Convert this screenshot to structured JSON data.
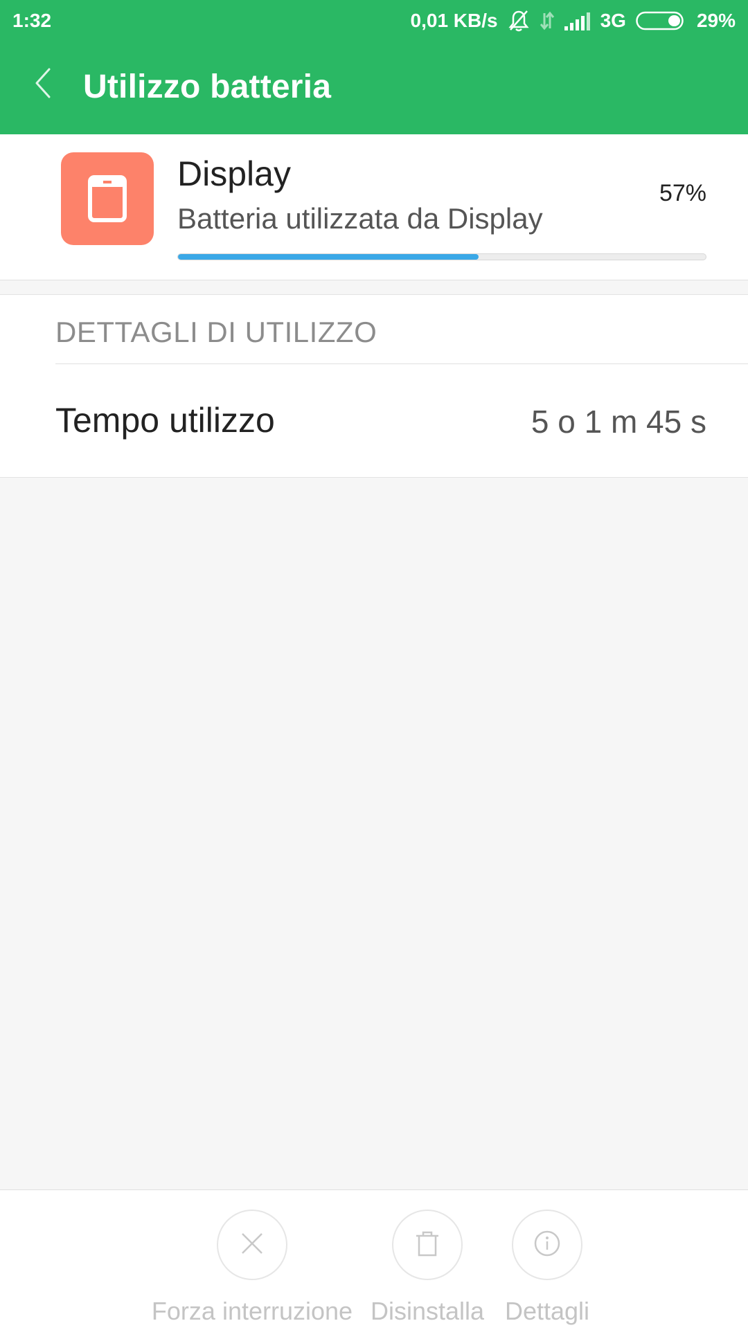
{
  "status_bar": {
    "time": "1:32",
    "net_speed": "0,01 KB/s",
    "network_type": "3G",
    "battery_percent": "29%",
    "icons": [
      "bell-off-icon",
      "data-arrows-icon",
      "signal-icon",
      "battery-icon"
    ],
    "battery_level": 0.29
  },
  "app_bar": {
    "title": "Utilizzo batteria",
    "back_icon": "chevron-left-icon"
  },
  "summary": {
    "app_name": "Display",
    "description": "Batteria utilizzata da Display",
    "percent_label": "57%",
    "percent_value": 57,
    "icon": "display-icon",
    "icon_color": "#fd826a",
    "bar_color": "#3aa8e7"
  },
  "details": {
    "header": "DETTAGLI DI UTILIZZO",
    "rows": [
      {
        "label": "Tempo utilizzo",
        "value": "5 o 1 m 45 s"
      }
    ]
  },
  "actions": [
    {
      "label": "Forza interruzione",
      "icon": "close-icon",
      "enabled": false
    },
    {
      "label": "Disinstalla",
      "icon": "trash-icon",
      "enabled": false
    },
    {
      "label": "Dettagli",
      "icon": "info-icon",
      "enabled": false
    }
  ],
  "colors": {
    "accent": "#2ab864",
    "background": "#f6f6f6",
    "disabled": "#c4c4c4"
  }
}
